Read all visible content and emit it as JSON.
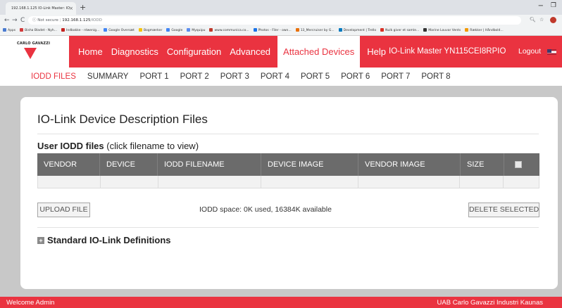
{
  "browser": {
    "tab_title": "192.168.1.125 IO-Link Master: IO",
    "tab_close": "×",
    "new_tab": "+",
    "minimize": "−",
    "maximize": "❐",
    "nav_back": "←",
    "nav_forward": "→",
    "nav_reload": "C",
    "security_label": "ⓘ Not secure",
    "url_host": "192.168.1.125",
    "url_path": "/IODD",
    "bookmarks": [
      {
        "label": "Apps",
        "color": "#4a7bd0"
      },
      {
        "label": "Bisha Bladet - Nyh...",
        "color": "#d23b3b"
      },
      {
        "label": "Indbakke - rdwenig...",
        "color": "#c5221f"
      },
      {
        "label": "Google Oversæt",
        "color": "#4285f4"
      },
      {
        "label": "Bogmærker",
        "color": "#f4c20d"
      },
      {
        "label": "Google",
        "color": "#4285f4"
      },
      {
        "label": "Myquipu",
        "color": "#5b8def"
      },
      {
        "label": "www.communica.co...",
        "color": "#c0392b"
      },
      {
        "label": "Photos - Filer - own...",
        "color": "#1a73e8"
      },
      {
        "label": "13_Mercruiser by G...",
        "color": "#e8710a"
      },
      {
        "label": "Development | Trello",
        "color": "#0079bf"
      },
      {
        "label": "Nulk giver et samle...",
        "color": "#d93025"
      },
      {
        "label": "Marine Louvar Vents",
        "color": "#333333"
      },
      {
        "label": "Rækker | Håndbold...",
        "color": "#f29900"
      }
    ]
  },
  "header": {
    "logo_text": "CARLO GAVAZZI",
    "nav": [
      "Home",
      "Diagnostics",
      "Configuration",
      "Advanced",
      "Attached Devices",
      "Help"
    ],
    "active_nav": "Attached Devices",
    "device_name": "IO-Link Master YN115CEI8RPIO",
    "logout": "Logout"
  },
  "subnav": [
    "IODD FILES",
    "SUMMARY",
    "PORT 1",
    "PORT 2",
    "PORT 3",
    "PORT 4",
    "PORT 5",
    "PORT 6",
    "PORT 7",
    "PORT 8"
  ],
  "main": {
    "title": "IO-Link Device Description Files",
    "user_iodd_bold": "User IODD files",
    "user_iodd_hint": " (click filename to view)",
    "columns": [
      "VENDOR",
      "DEVICE",
      "IODD FILENAME",
      "DEVICE IMAGE",
      "VENDOR IMAGE",
      "SIZE"
    ],
    "upload_button": "UPLOAD FILE",
    "space_info": "IODD space: 0K used, 16384K available",
    "delete_button": "DELETE SELECTED",
    "standard_defs": "Standard IO-Link Definitions",
    "expand_symbol": "+"
  },
  "footer": {
    "left": "Welcome Admin",
    "right": "UAB Carlo Gavazzi Industri Kaunas"
  },
  "colors": {
    "brand_red": "#ea3340",
    "table_header": "#6b6b6b",
    "content_bg": "#c8c8c8"
  }
}
